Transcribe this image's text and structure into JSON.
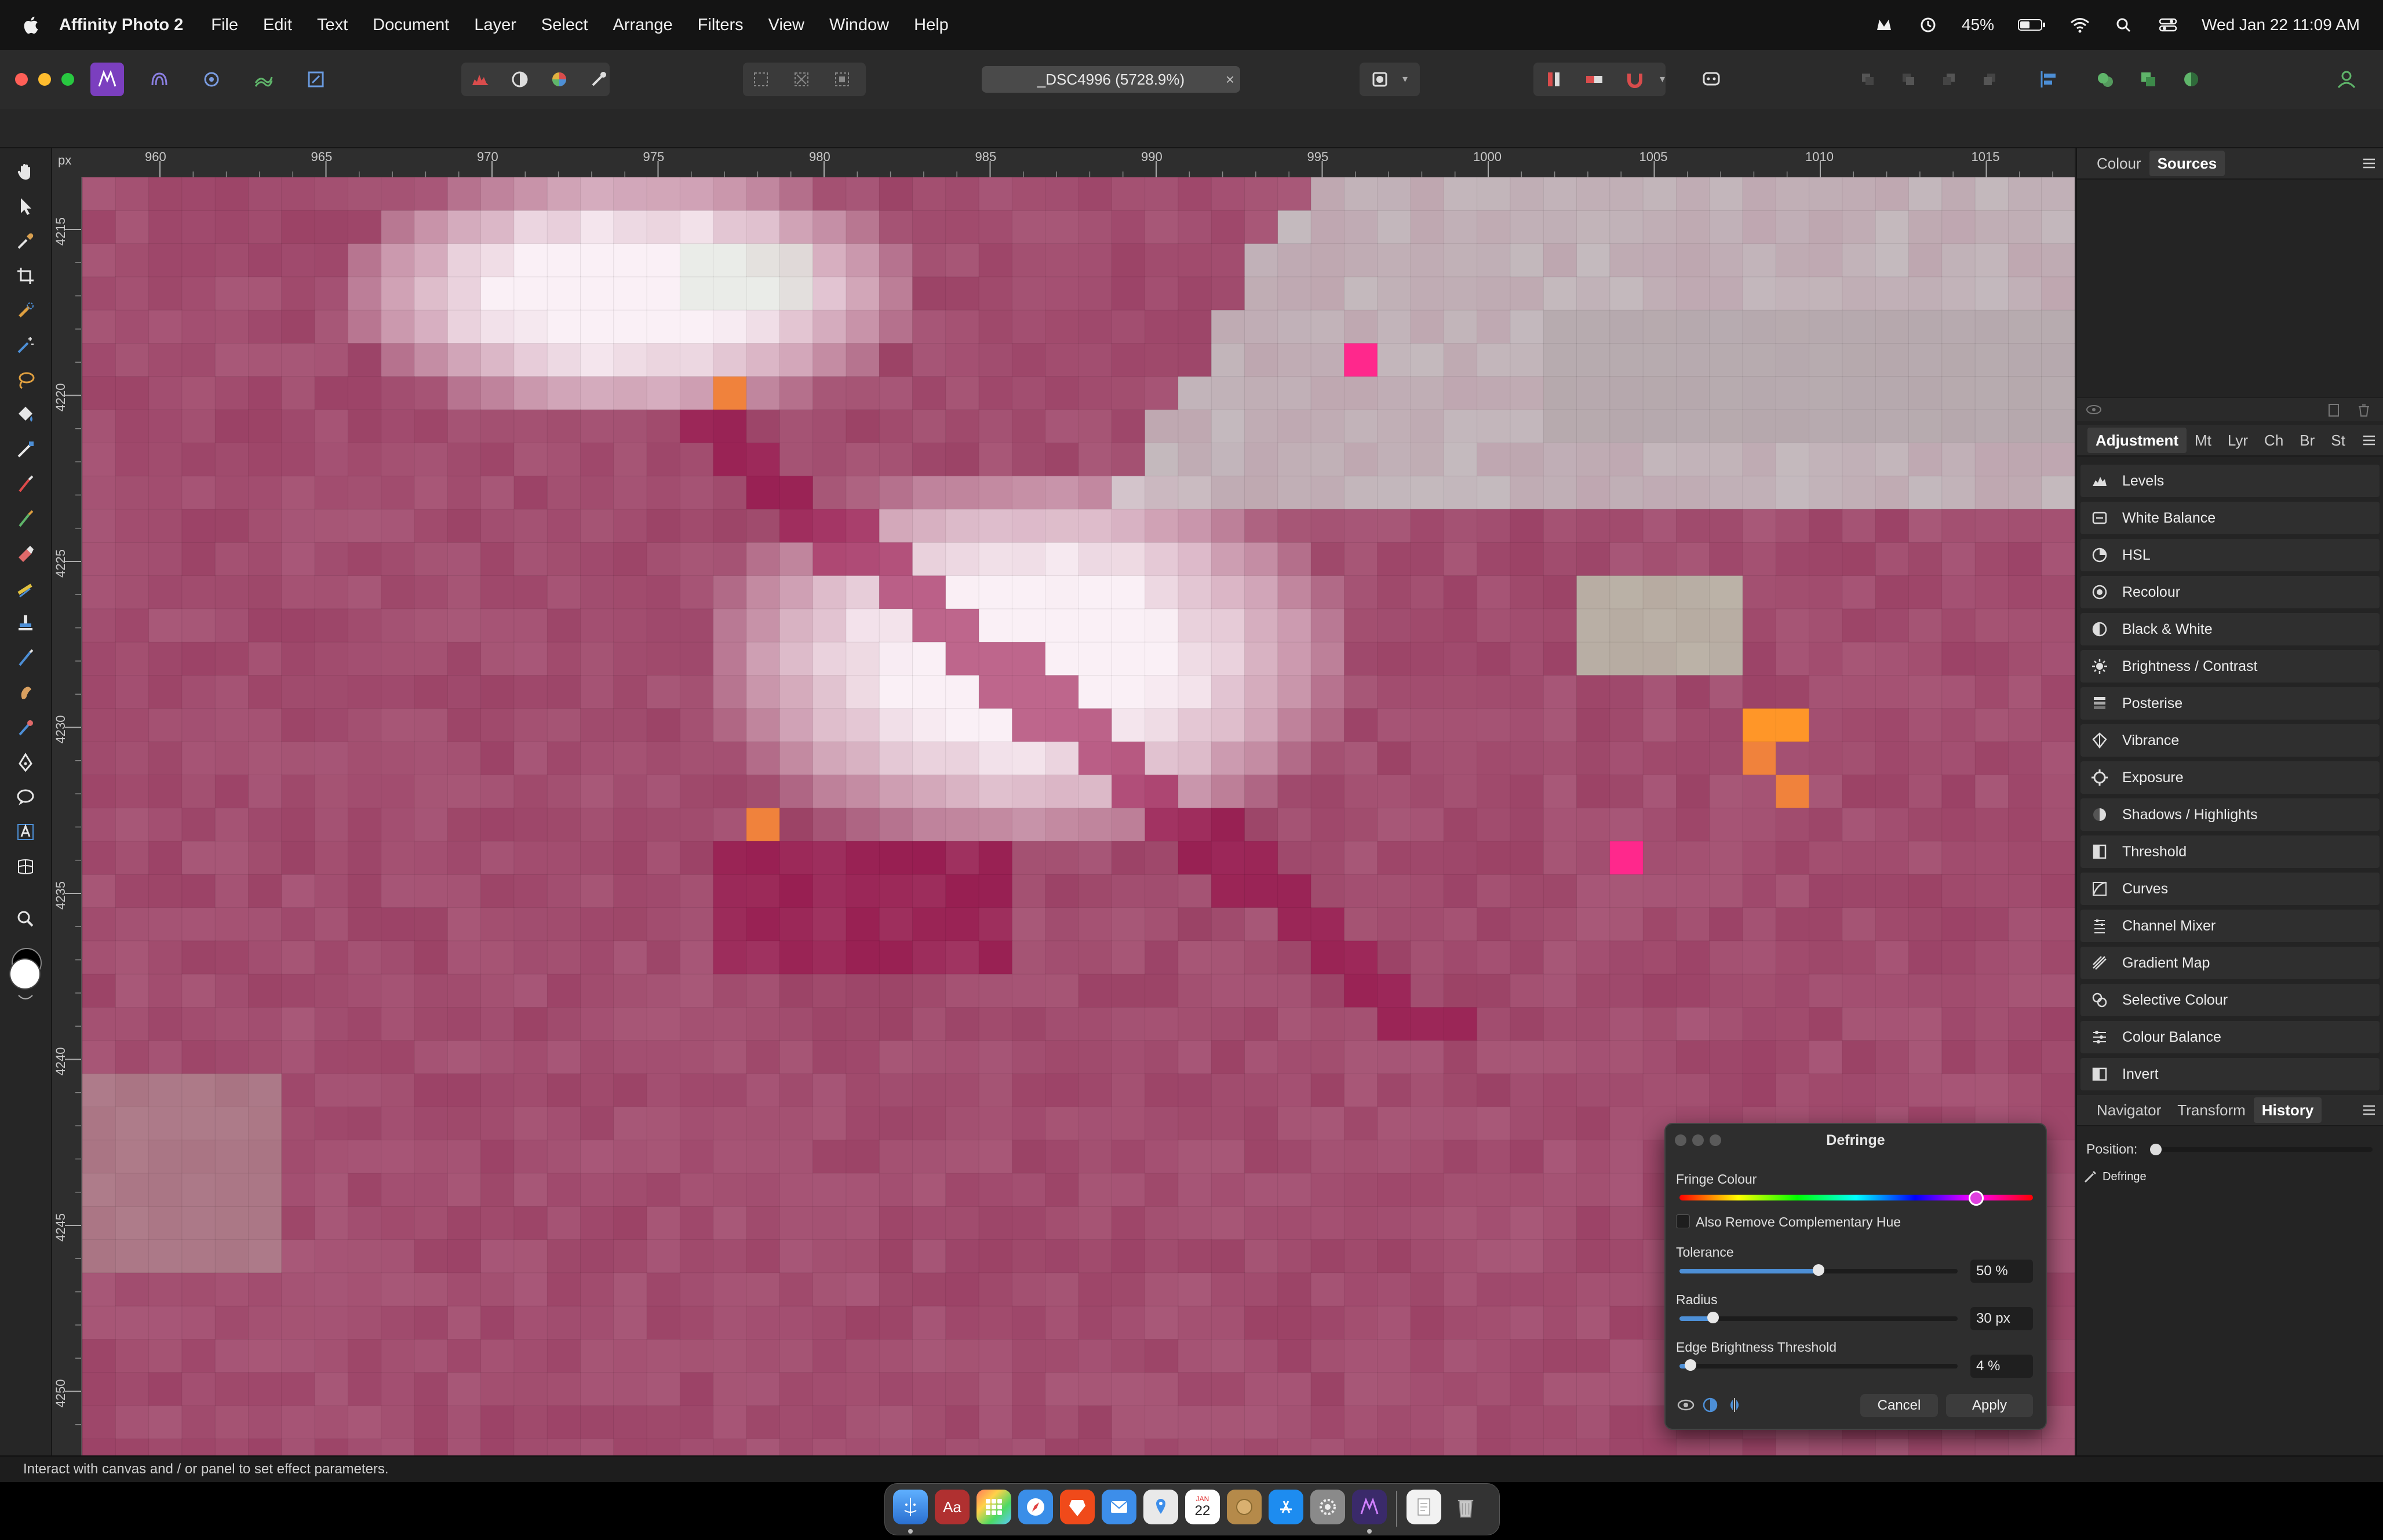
{
  "menubar": {
    "app_name": "Affinity Photo 2",
    "menus": [
      "File",
      "Edit",
      "Text",
      "Document",
      "Layer",
      "Select",
      "Arrange",
      "Filters",
      "View",
      "Window",
      "Help"
    ],
    "battery": "45%",
    "datetime": "Wed Jan 22  11:09 AM"
  },
  "toolbar": {
    "document_title": "_DSC4996 (5728.9%)",
    "close_glyph": "×"
  },
  "ruler": {
    "unit": "px",
    "h_ticks": [
      "960",
      "965",
      "970",
      "975",
      "980",
      "985",
      "990",
      "995",
      "1000",
      "1005",
      "1010",
      "1015"
    ],
    "v_ticks": [
      "4215",
      "4220",
      "4225",
      "4230",
      "4235",
      "4240",
      "4245",
      "4250"
    ]
  },
  "top_panel": {
    "tabs": [
      "Colour",
      "Sources"
    ],
    "active": "Sources"
  },
  "adjustment_panel": {
    "tabs": [
      "Adjustment",
      "Mt",
      "Lyr",
      "Ch",
      "Br",
      "St"
    ],
    "active": "Adjustment",
    "items": [
      {
        "label": "Levels",
        "icon": "levels-icon"
      },
      {
        "label": "White Balance",
        "icon": "white-balance-icon"
      },
      {
        "label": "HSL",
        "icon": "hsl-icon"
      },
      {
        "label": "Recolour",
        "icon": "recolour-icon"
      },
      {
        "label": "Black & White",
        "icon": "black-white-icon"
      },
      {
        "label": "Brightness / Contrast",
        "icon": "brightness-icon"
      },
      {
        "label": "Posterise",
        "icon": "posterise-icon"
      },
      {
        "label": "Vibrance",
        "icon": "vibrance-icon"
      },
      {
        "label": "Exposure",
        "icon": "exposure-icon"
      },
      {
        "label": "Shadows / Highlights",
        "icon": "shadows-highlights-icon"
      },
      {
        "label": "Threshold",
        "icon": "threshold-icon"
      },
      {
        "label": "Curves",
        "icon": "curves-icon"
      },
      {
        "label": "Channel Mixer",
        "icon": "channel-mixer-icon"
      },
      {
        "label": "Gradient Map",
        "icon": "gradient-map-icon"
      },
      {
        "label": "Selective Colour",
        "icon": "selective-colour-icon"
      },
      {
        "label": "Colour Balance",
        "icon": "colour-balance-icon"
      },
      {
        "label": "Invert",
        "icon": "invert-icon"
      }
    ]
  },
  "history_panel": {
    "tabs": [
      "Navigator",
      "Transform",
      "History"
    ],
    "active": "History",
    "position_label": "Position:",
    "entries": [
      "Defringe"
    ]
  },
  "defringe_dialog": {
    "title": "Defringe",
    "fringe_colour_label": "Fringe Colour",
    "complementary_label": "Also Remove Complementary Hue",
    "tolerance_label": "Tolerance",
    "tolerance_value": "50 %",
    "tolerance_fraction": 0.5,
    "radius_label": "Radius",
    "radius_value": "30 px",
    "radius_fraction": 0.12,
    "edge_label": "Edge Brightness Threshold",
    "edge_value": "4 %",
    "edge_fraction": 0.04,
    "hue_fraction": 0.84,
    "cancel_label": "Cancel",
    "apply_label": "Apply"
  },
  "status": {
    "message": "Interact with canvas and / or panel to set effect parameters."
  },
  "dock": {
    "calendar_day": "22",
    "calendar_month": "JAN",
    "dictionary_glyph": "Aa"
  },
  "colors": {
    "accent": "#4d8fd6",
    "traffic_red": "#ff5f57",
    "traffic_yellow": "#febc2e",
    "traffic_green": "#28c840"
  }
}
